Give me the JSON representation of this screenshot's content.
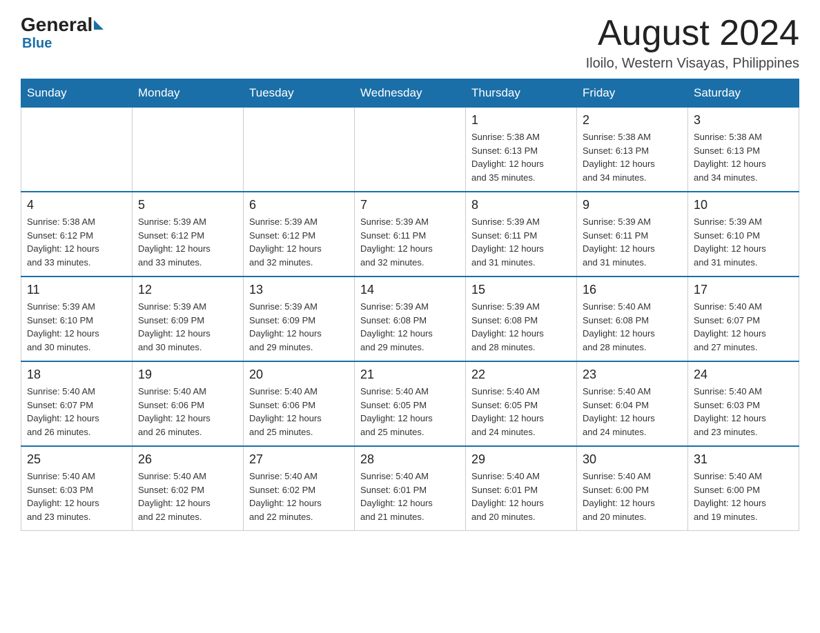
{
  "logo": {
    "text_general": "General",
    "text_blue": "Blue"
  },
  "title": "August 2024",
  "subtitle": "Iloilo, Western Visayas, Philippines",
  "days_of_week": [
    "Sunday",
    "Monday",
    "Tuesday",
    "Wednesday",
    "Thursday",
    "Friday",
    "Saturday"
  ],
  "weeks": [
    [
      {
        "day": "",
        "info": ""
      },
      {
        "day": "",
        "info": ""
      },
      {
        "day": "",
        "info": ""
      },
      {
        "day": "",
        "info": ""
      },
      {
        "day": "1",
        "info": "Sunrise: 5:38 AM\nSunset: 6:13 PM\nDaylight: 12 hours\nand 35 minutes."
      },
      {
        "day": "2",
        "info": "Sunrise: 5:38 AM\nSunset: 6:13 PM\nDaylight: 12 hours\nand 34 minutes."
      },
      {
        "day": "3",
        "info": "Sunrise: 5:38 AM\nSunset: 6:13 PM\nDaylight: 12 hours\nand 34 minutes."
      }
    ],
    [
      {
        "day": "4",
        "info": "Sunrise: 5:38 AM\nSunset: 6:12 PM\nDaylight: 12 hours\nand 33 minutes."
      },
      {
        "day": "5",
        "info": "Sunrise: 5:39 AM\nSunset: 6:12 PM\nDaylight: 12 hours\nand 33 minutes."
      },
      {
        "day": "6",
        "info": "Sunrise: 5:39 AM\nSunset: 6:12 PM\nDaylight: 12 hours\nand 32 minutes."
      },
      {
        "day": "7",
        "info": "Sunrise: 5:39 AM\nSunset: 6:11 PM\nDaylight: 12 hours\nand 32 minutes."
      },
      {
        "day": "8",
        "info": "Sunrise: 5:39 AM\nSunset: 6:11 PM\nDaylight: 12 hours\nand 31 minutes."
      },
      {
        "day": "9",
        "info": "Sunrise: 5:39 AM\nSunset: 6:11 PM\nDaylight: 12 hours\nand 31 minutes."
      },
      {
        "day": "10",
        "info": "Sunrise: 5:39 AM\nSunset: 6:10 PM\nDaylight: 12 hours\nand 31 minutes."
      }
    ],
    [
      {
        "day": "11",
        "info": "Sunrise: 5:39 AM\nSunset: 6:10 PM\nDaylight: 12 hours\nand 30 minutes."
      },
      {
        "day": "12",
        "info": "Sunrise: 5:39 AM\nSunset: 6:09 PM\nDaylight: 12 hours\nand 30 minutes."
      },
      {
        "day": "13",
        "info": "Sunrise: 5:39 AM\nSunset: 6:09 PM\nDaylight: 12 hours\nand 29 minutes."
      },
      {
        "day": "14",
        "info": "Sunrise: 5:39 AM\nSunset: 6:08 PM\nDaylight: 12 hours\nand 29 minutes."
      },
      {
        "day": "15",
        "info": "Sunrise: 5:39 AM\nSunset: 6:08 PM\nDaylight: 12 hours\nand 28 minutes."
      },
      {
        "day": "16",
        "info": "Sunrise: 5:40 AM\nSunset: 6:08 PM\nDaylight: 12 hours\nand 28 minutes."
      },
      {
        "day": "17",
        "info": "Sunrise: 5:40 AM\nSunset: 6:07 PM\nDaylight: 12 hours\nand 27 minutes."
      }
    ],
    [
      {
        "day": "18",
        "info": "Sunrise: 5:40 AM\nSunset: 6:07 PM\nDaylight: 12 hours\nand 26 minutes."
      },
      {
        "day": "19",
        "info": "Sunrise: 5:40 AM\nSunset: 6:06 PM\nDaylight: 12 hours\nand 26 minutes."
      },
      {
        "day": "20",
        "info": "Sunrise: 5:40 AM\nSunset: 6:06 PM\nDaylight: 12 hours\nand 25 minutes."
      },
      {
        "day": "21",
        "info": "Sunrise: 5:40 AM\nSunset: 6:05 PM\nDaylight: 12 hours\nand 25 minutes."
      },
      {
        "day": "22",
        "info": "Sunrise: 5:40 AM\nSunset: 6:05 PM\nDaylight: 12 hours\nand 24 minutes."
      },
      {
        "day": "23",
        "info": "Sunrise: 5:40 AM\nSunset: 6:04 PM\nDaylight: 12 hours\nand 24 minutes."
      },
      {
        "day": "24",
        "info": "Sunrise: 5:40 AM\nSunset: 6:03 PM\nDaylight: 12 hours\nand 23 minutes."
      }
    ],
    [
      {
        "day": "25",
        "info": "Sunrise: 5:40 AM\nSunset: 6:03 PM\nDaylight: 12 hours\nand 23 minutes."
      },
      {
        "day": "26",
        "info": "Sunrise: 5:40 AM\nSunset: 6:02 PM\nDaylight: 12 hours\nand 22 minutes."
      },
      {
        "day": "27",
        "info": "Sunrise: 5:40 AM\nSunset: 6:02 PM\nDaylight: 12 hours\nand 22 minutes."
      },
      {
        "day": "28",
        "info": "Sunrise: 5:40 AM\nSunset: 6:01 PM\nDaylight: 12 hours\nand 21 minutes."
      },
      {
        "day": "29",
        "info": "Sunrise: 5:40 AM\nSunset: 6:01 PM\nDaylight: 12 hours\nand 20 minutes."
      },
      {
        "day": "30",
        "info": "Sunrise: 5:40 AM\nSunset: 6:00 PM\nDaylight: 12 hours\nand 20 minutes."
      },
      {
        "day": "31",
        "info": "Sunrise: 5:40 AM\nSunset: 6:00 PM\nDaylight: 12 hours\nand 19 minutes."
      }
    ]
  ]
}
